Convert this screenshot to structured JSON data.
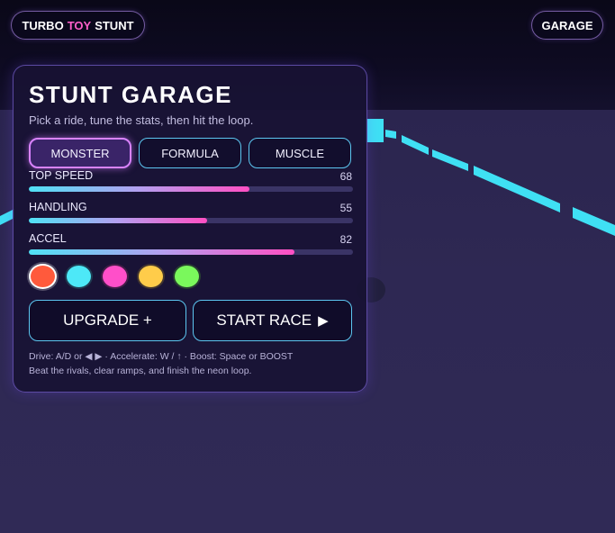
{
  "hud": {
    "title_left": "TURBO",
    "title_mid": "TOY",
    "title_right": "STUNT",
    "garage_label": "GARAGE"
  },
  "garage": {
    "title": "STUNT GARAGE",
    "subtitle": "Pick a ride, tune the stats, then hit the loop.",
    "cars": [
      {
        "label": "MONSTER",
        "selected": true
      },
      {
        "label": "FORMULA",
        "selected": false
      },
      {
        "label": "MUSCLE",
        "selected": false
      }
    ],
    "stats": [
      {
        "label": "TOP SPEED",
        "value": "68",
        "fill": 0.68
      },
      {
        "label": "HANDLING",
        "value": "55",
        "fill": 0.55
      },
      {
        "label": "ACCEL",
        "value": "82",
        "fill": 0.82
      }
    ],
    "paint_colors": [
      "#ff5a3c",
      "#4de8f7",
      "#ff4fc9",
      "#ffcc4a",
      "#7af85c"
    ],
    "selected_color_index": 0,
    "upgrade_label": "UPGRADE +",
    "start_label": "START RACE",
    "start_icon": "play-icon",
    "help_line1": "Drive: A/D or ◀ ▶ · Accelerate: W / ↑ · Boost: Space or BOOST",
    "help_line2": "Beat the rivals, clear ramps, and finish the neon loop."
  },
  "colors": {
    "accent_pink": "#ff5fc9",
    "accent_cyan": "#4fe2f5",
    "panel_border": "#9678ff"
  }
}
